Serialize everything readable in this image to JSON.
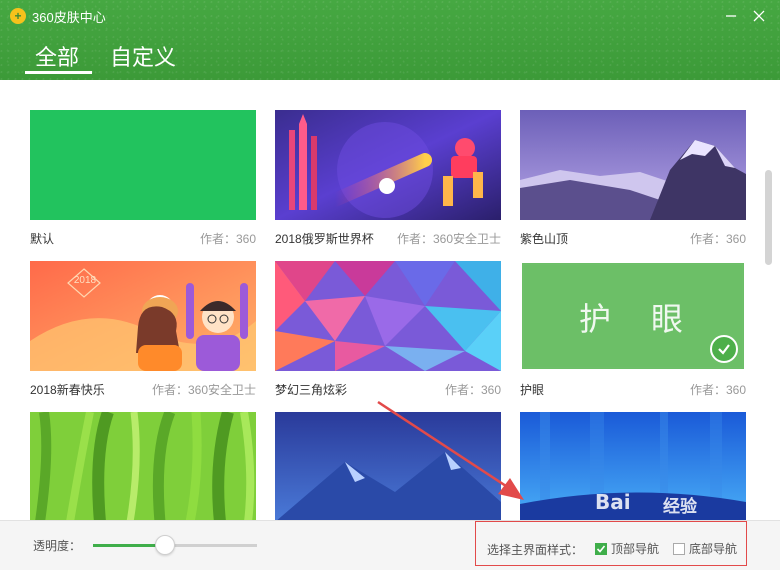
{
  "app": {
    "title": "360皮肤中心"
  },
  "tabs": [
    {
      "label": "全部"
    },
    {
      "label": "自定义"
    }
  ],
  "skins": [
    {
      "name": "默认",
      "author": "作者：360"
    },
    {
      "name": "2018俄罗斯世界杯",
      "author": "作者：360安全卫士"
    },
    {
      "name": "紫色山顶",
      "author": "作者：360"
    },
    {
      "name": "2018新春快乐",
      "author": "作者：360安全卫士",
      "year_badge": "2018"
    },
    {
      "name": "梦幻三角炫彩",
      "author": "作者：360"
    },
    {
      "name": "护眼",
      "author": "作者：360",
      "thumb_text": "护　眼",
      "selected": true
    },
    {
      "name": "",
      "author": ""
    },
    {
      "name": "",
      "author": ""
    },
    {
      "name": "",
      "author": ""
    }
  ],
  "bottom": {
    "opacity_label": "透明度：",
    "opacity_value": 0.44,
    "style_label": "选择主界面样式：",
    "options": [
      {
        "label": "顶部导航",
        "checked": true
      },
      {
        "label": "底部导航",
        "checked": false
      }
    ]
  },
  "watermark": {
    "brand": "Bai",
    "suffix": "经验"
  },
  "colors": {
    "header": "#3f9e3b",
    "accent": "#3fae4a",
    "annotation": "#e24a4a"
  },
  "icons": [
    "app-logo-icon",
    "minimize-icon",
    "close-icon",
    "check-icon",
    "checkbox-icon"
  ]
}
